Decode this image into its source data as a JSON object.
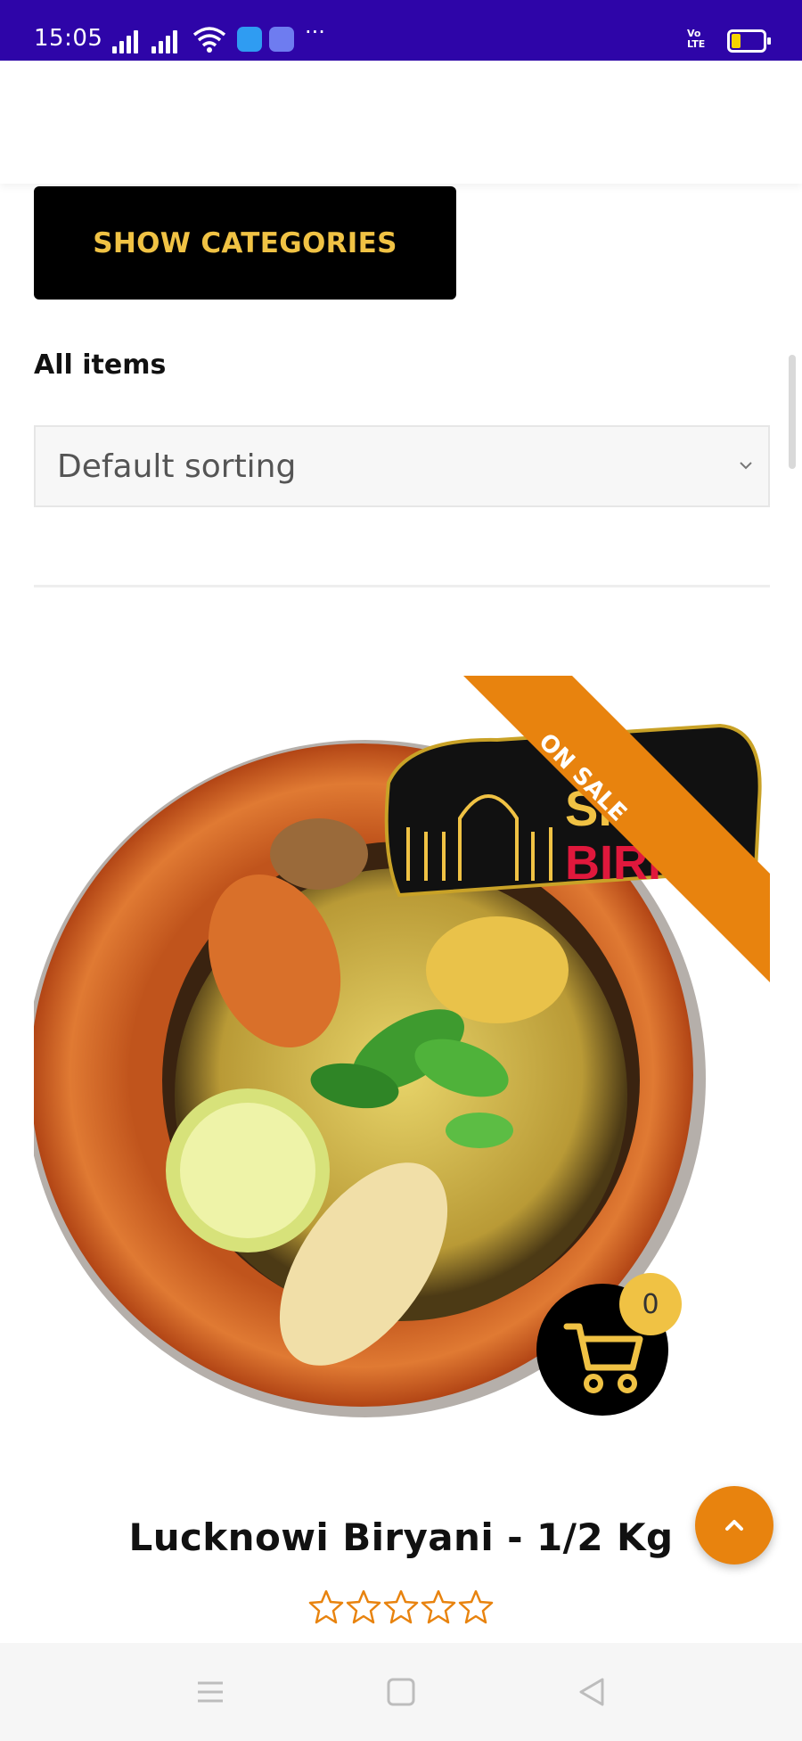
{
  "status_bar": {
    "time": "15:05",
    "more": "···",
    "volte_line1": "Vo",
    "volte_line2": "LTE",
    "battery_level": 0.25,
    "colors": {
      "background": "#2e05a8",
      "battery_fill": "#f5d400"
    }
  },
  "toolbar": {
    "show_categories_label": "SHOW CATEGORIES"
  },
  "filter": {
    "all_items_label": "All items",
    "sort_selected": "Default sorting"
  },
  "product": {
    "title": "Lucknowi Biryani - 1/2 Kg",
    "sale_badge": "ON SALE",
    "logo_text_top": "SHA",
    "logo_text_bottom": "BIRIYA",
    "rating_stars": 0,
    "rating_max": 5
  },
  "cart": {
    "count": "0"
  },
  "colors": {
    "accent_orange": "#e8830e",
    "accent_gold": "#f0c244",
    "button_dark": "#000000"
  },
  "icons": {
    "cart": "cart-icon",
    "scroll_top": "chevron-up-icon",
    "sort": "chevron-down-icon",
    "nav": [
      "menu-icon",
      "home-icon",
      "back-icon"
    ]
  }
}
